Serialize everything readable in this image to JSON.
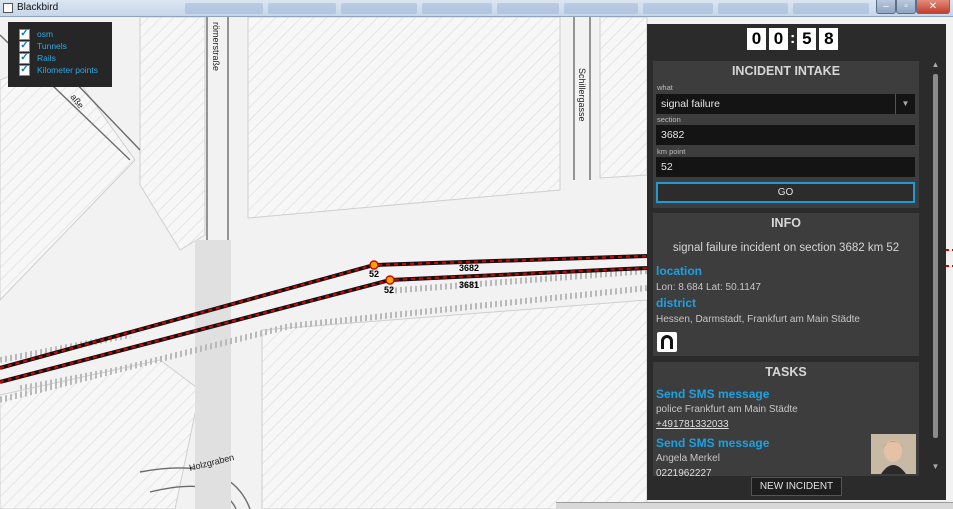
{
  "window": {
    "title": "Blackbird"
  },
  "layers": [
    {
      "label": "osm",
      "checked": true
    },
    {
      "label": "Tunnels",
      "checked": true
    },
    {
      "label": "Rails",
      "checked": true
    },
    {
      "label": "Kilometer points",
      "checked": true
    }
  ],
  "map": {
    "streets": {
      "roemerstrasse": "römerstraße",
      "schillergasse": "Schillergasse",
      "holzgraben": "Holzgraben",
      "strasse_left": "aße"
    },
    "km_labels": {
      "km_top": "52",
      "km_bottom": "52",
      "section_top": "3682",
      "section_bottom": "3681"
    }
  },
  "timer": {
    "digits": [
      "0",
      "0",
      "5",
      "8"
    ],
    "separator": ":"
  },
  "intake": {
    "title": "INCIDENT INTAKE",
    "what_label": "what",
    "what_value": "signal failure",
    "section_label": "section",
    "section_value": "3682",
    "km_label": "km point",
    "km_value": "52",
    "go_label": "GO"
  },
  "info": {
    "title": "INFO",
    "message": "signal failure incident on section 3682 km 52",
    "location_label": "location",
    "location_value": "Lon: 8.684 Lat: 50.1147",
    "district_label": "district",
    "district_value": "Hessen, Darmstadt, Frankfurt am Main Städte",
    "tunnel_icon": "tunnel-icon"
  },
  "tasks": {
    "title": "TASKS",
    "items": [
      {
        "action": "Send SMS message",
        "recipient": "police  Frankfurt am Main Städte",
        "phone": "+491781332033"
      },
      {
        "action": "Send SMS message",
        "recipient": "Angela Merkel",
        "phone": "0221962227"
      }
    ]
  },
  "new_incident_label": "NEW INCIDENT",
  "colors": {
    "panel_bg": "#2b2b2b",
    "box_bg": "#3d3d3d",
    "accent": "#1ca1e3",
    "rail_red": "#d90000"
  }
}
